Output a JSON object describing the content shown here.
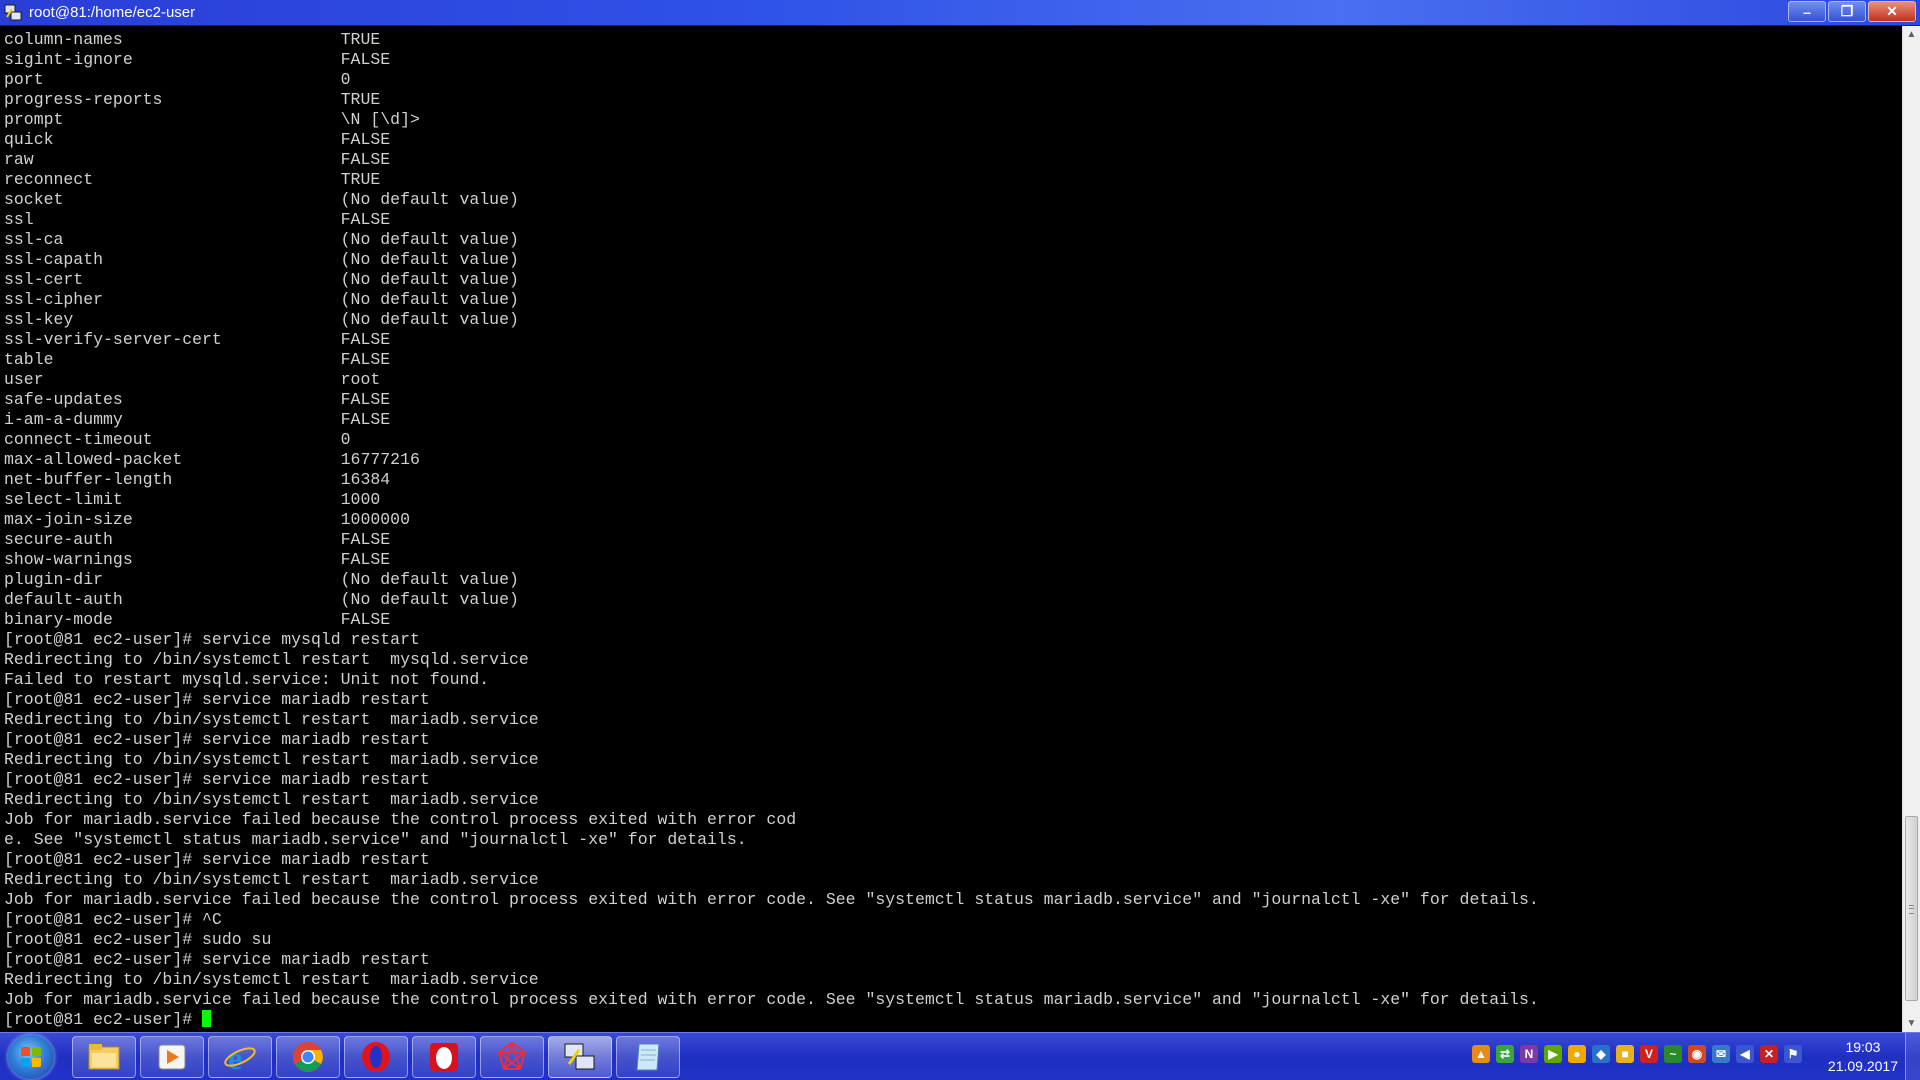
{
  "window": {
    "title": "root@81:/home/ec2-user",
    "minimize": "–",
    "maximize": "❐",
    "close": "✕"
  },
  "terminal": {
    "lines": [
      "column-names                      TRUE",
      "sigint-ignore                     FALSE",
      "port                              0",
      "progress-reports                  TRUE",
      "prompt                            \\N [\\d]>",
      "quick                             FALSE",
      "raw                               FALSE",
      "reconnect                         TRUE",
      "socket                            (No default value)",
      "ssl                               FALSE",
      "ssl-ca                            (No default value)",
      "ssl-capath                        (No default value)",
      "ssl-cert                          (No default value)",
      "ssl-cipher                        (No default value)",
      "ssl-key                           (No default value)",
      "ssl-verify-server-cert            FALSE",
      "table                             FALSE",
      "user                              root",
      "safe-updates                      FALSE",
      "i-am-a-dummy                      FALSE",
      "connect-timeout                   0",
      "max-allowed-packet                16777216",
      "net-buffer-length                 16384",
      "select-limit                      1000",
      "max-join-size                     1000000",
      "secure-auth                       FALSE",
      "show-warnings                     FALSE",
      "plugin-dir                        (No default value)",
      "default-auth                      (No default value)",
      "binary-mode                       FALSE",
      "[root@81 ec2-user]# service mysqld restart",
      "Redirecting to /bin/systemctl restart  mysqld.service",
      "Failed to restart mysqld.service: Unit not found.",
      "[root@81 ec2-user]# service mariadb restart",
      "Redirecting to /bin/systemctl restart  mariadb.service",
      "[root@81 ec2-user]# service mariadb restart",
      "Redirecting to /bin/systemctl restart  mariadb.service",
      "[root@81 ec2-user]# service mariadb restart",
      "Redirecting to /bin/systemctl restart  mariadb.service",
      "Job for mariadb.service failed because the control process exited with error cod",
      "e. See \"systemctl status mariadb.service\" and \"journalctl -xe\" for details.",
      "[root@81 ec2-user]# service mariadb restart",
      "Redirecting to /bin/systemctl restart  mariadb.service",
      "Job for mariadb.service failed because the control process exited with error code. See \"systemctl status mariadb.service\" and \"journalctl -xe\" for details.",
      "[root@81 ec2-user]# ^C",
      "[root@81 ec2-user]# sudo su",
      "[root@81 ec2-user]# service mariadb restart",
      "Redirecting to /bin/systemctl restart  mariadb.service",
      "Job for mariadb.service failed because the control process exited with error code. See \"systemctl status mariadb.service\" and \"journalctl -xe\" for details."
    ],
    "prompt": "[root@81 ec2-user]# ",
    "cursor_color": "#00ff00",
    "text_color": "#d0d0d0",
    "background": "#000000"
  },
  "taskbar": {
    "apps": [
      {
        "name": "file-explorer-icon"
      },
      {
        "name": "media-player-icon"
      },
      {
        "name": "internet-explorer-icon"
      },
      {
        "name": "chrome-icon"
      },
      {
        "name": "opera-icon"
      },
      {
        "name": "egg-app-icon"
      },
      {
        "name": "network-app-icon"
      },
      {
        "name": "putty-icon",
        "active": true
      },
      {
        "name": "notepad-icon"
      }
    ],
    "tray": [
      {
        "name": "tray-app-icon-1",
        "glyph": "▲",
        "color": "#e8891c"
      },
      {
        "name": "tray-app-icon-2",
        "glyph": "⇄",
        "color": "#3aa63a"
      },
      {
        "name": "onenote-icon",
        "glyph": "N",
        "color": "#7b3aa8"
      },
      {
        "name": "nvidia-icon",
        "glyph": "▶",
        "color": "#5fa800"
      },
      {
        "name": "tray-app-icon-3",
        "glyph": "●",
        "color": "#f0a800"
      },
      {
        "name": "tray-app-icon-4",
        "glyph": "◆",
        "color": "#2a72c8"
      },
      {
        "name": "tray-app-icon-5",
        "glyph": "■",
        "color": "#e8b020"
      },
      {
        "name": "antivirus-icon",
        "glyph": "V",
        "color": "#d02020"
      },
      {
        "name": "tray-app-icon-6",
        "glyph": "~",
        "color": "#2a8a2a"
      },
      {
        "name": "chrome-tray-icon",
        "glyph": "◉",
        "color": "#d04a20"
      },
      {
        "name": "tray-app-icon-7",
        "glyph": "✉",
        "color": "#3a78c8"
      },
      {
        "name": "volume-icon",
        "glyph": "◀",
        "color": "#3a56d0"
      },
      {
        "name": "network-error-icon",
        "glyph": "✕",
        "color": "#c82020"
      },
      {
        "name": "action-center-icon",
        "glyph": "⚑",
        "color": "#3a56d0"
      }
    ],
    "time": "19:03",
    "date": "21.09.2017"
  }
}
